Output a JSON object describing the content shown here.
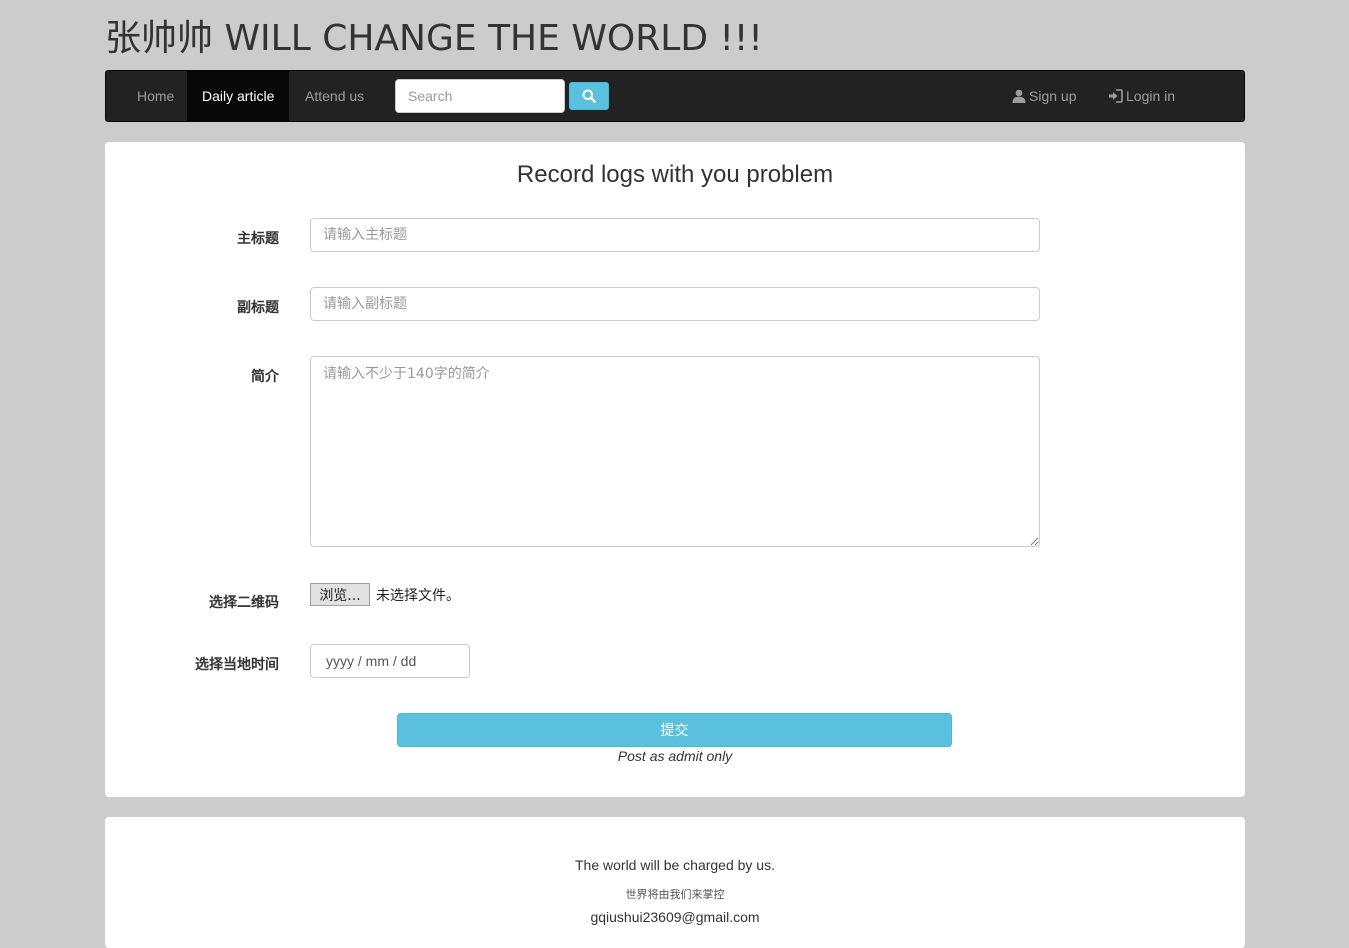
{
  "site": {
    "title": "张帅帅 WILL CHANGE THE WORLD !!!"
  },
  "nav": {
    "items": [
      {
        "label": "Home",
        "active": false
      },
      {
        "label": "Daily article",
        "active": true
      },
      {
        "label": "Attend us",
        "active": false
      }
    ],
    "search_placeholder": "Search",
    "search_icon": "search-icon",
    "signup_label": "Sign up",
    "signup_icon": "user-icon",
    "login_label": "Login in",
    "login_icon": "login-icon"
  },
  "form": {
    "heading": "Record logs with you problem",
    "main_title": {
      "label": "主标题",
      "placeholder": "请输入主标题",
      "value": ""
    },
    "subtitle": {
      "label": "副标题",
      "placeholder": "请输入副标题",
      "value": ""
    },
    "intro": {
      "label": "简介",
      "placeholder": "请输入不少于140字的简介",
      "value": ""
    },
    "qr_code": {
      "label": "选择二维码",
      "button": "浏览...",
      "status": "未选择文件。"
    },
    "local_time": {
      "label": "选择当地时间",
      "value": "yyyy / mm / dd"
    },
    "submit_label": "提交",
    "note": "Post as admit only"
  },
  "footer": {
    "line_en": "The world will be charged by us.",
    "line_cn": "世界将由我们来掌控",
    "email": "gqiushui23609@gmail.com"
  },
  "colors": {
    "page_bg": "#cccccc",
    "navbar_bg": "#222222",
    "navbar_active": "#080808",
    "accent": "#5bc0de"
  }
}
